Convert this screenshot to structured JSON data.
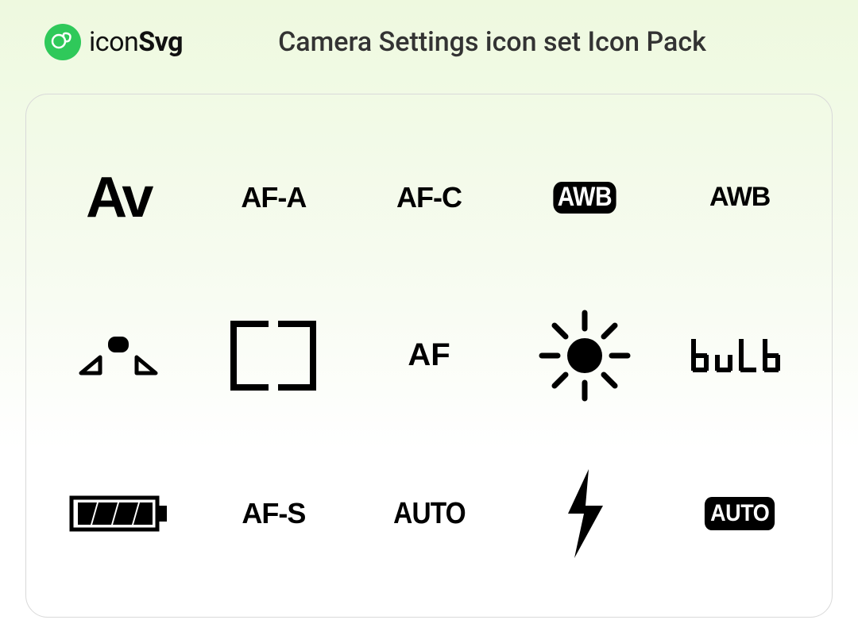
{
  "brand": {
    "name_thin": "icon",
    "name_bold": "Svg"
  },
  "page_title": "Camera Settings icon set Icon Pack",
  "icons": {
    "av": "Av",
    "af_a": "AF-A",
    "af_c": "AF-C",
    "awb_badge": "AWB",
    "awb_plain": "AWB",
    "af_area": "AF-Area",
    "focus_bracket": "Focus-Bracket",
    "af": "AF",
    "sun": "Daylight-WB",
    "bulb": "buLb",
    "battery": "Battery-Full",
    "af_s": "AF-S",
    "auto_plain": "AUTO",
    "flash": "Flash",
    "auto_badge": "AUTO"
  }
}
